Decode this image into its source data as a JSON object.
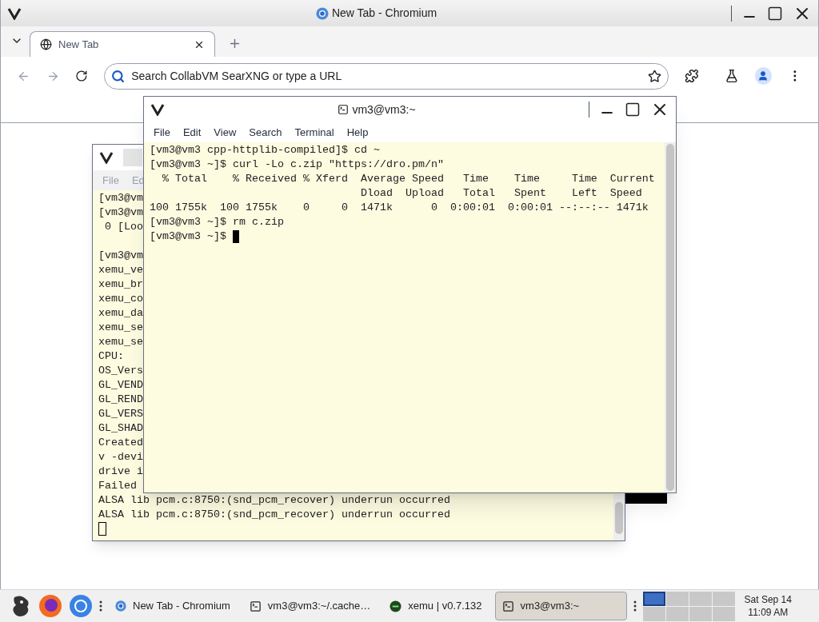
{
  "browser": {
    "title": "New Tab - Chromium",
    "tabs": [
      {
        "label": "New Tab",
        "selected": true
      }
    ],
    "address_placeholder": "Search CollabVM SearXNG or type a URL"
  },
  "back_terminal": {
    "menu": [
      "File",
      "Ed"
    ],
    "blocks": [
      [
        "[vm3@vm",
        "[vm3@vm",
        " 0 [Loo"
      ],
      [
        "[vm3@vm",
        "xemu_ve",
        "xemu_br",
        "xemu_co",
        "xemu_da",
        "xemu_se",
        "xemu_se",
        "CPU:",
        "OS_Vers",
        "GL_VEND",
        "GL_REND",
        "GL_VERS",
        "GL_SHAD",
        "Created",
        "v -devi",
        "drive i",
        "Failed",
        "ALSA lib pcm.c:8750:(snd_pcm_recover) underrun occurred",
        "ALSA lib pcm.c:8750:(snd_pcm_recover) underrun occurred"
      ]
    ]
  },
  "front_terminal": {
    "title": "vm3@vm3:~",
    "menu": [
      "File",
      "Edit",
      "View",
      "Search",
      "Terminal",
      "Help"
    ],
    "lines": [
      "[vm3@vm3 cpp-httplib-compiled]$ cd ~",
      "[vm3@vm3 ~]$ curl -Lo c.zip \"https://dro.pm/n\"",
      "  % Total    % Received % Xferd  Average Speed   Time    Time     Time  Current",
      "                                 Dload  Upload   Total   Spent    Left  Speed",
      "100 1755k  100 1755k    0     0  1471k      0  0:00:01  0:00:01 --:--:-- 1471k",
      "[vm3@vm3 ~]$ rm c.zip",
      "[vm3@vm3 ~]$ "
    ]
  },
  "taskbar": {
    "tasks": [
      {
        "kind": "chromium",
        "label": "New Tab - Chromium",
        "selected": false
      },
      {
        "kind": "terminal",
        "label": "vm3@vm3:~/.cache…",
        "selected": false
      },
      {
        "kind": "xemu",
        "label": "xemu | v0.7.132",
        "selected": false
      },
      {
        "kind": "terminal",
        "label": "vm3@vm3:~",
        "selected": true
      }
    ],
    "workspaces": [
      {
        "selected": true
      },
      {
        "selected": false
      },
      {
        "selected": false
      },
      {
        "selected": false
      },
      {
        "selected": false
      },
      {
        "selected": false
      },
      {
        "selected": false
      },
      {
        "selected": false
      }
    ],
    "clock": {
      "date": "Sat Sep 14",
      "time": "11:09 AM"
    }
  }
}
